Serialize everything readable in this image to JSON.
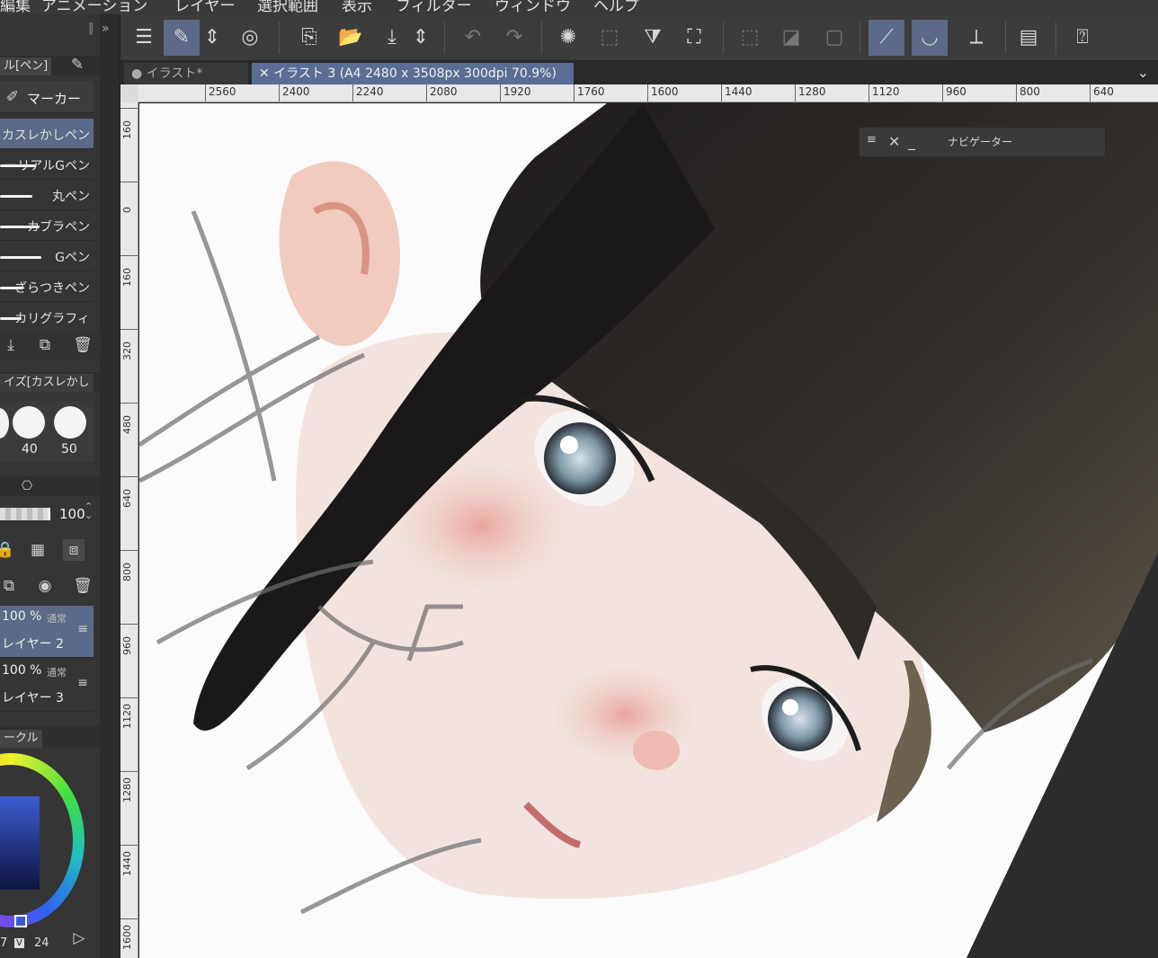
{
  "menu": [
    "編集",
    "アニメーション",
    "レイヤー",
    "選択範囲",
    "表示",
    "フィルター",
    "ウィンドウ",
    "ヘルプ"
  ],
  "tool_panel": {
    "tabs": [
      "ル[ペン]"
    ],
    "group": "マーカー",
    "brushes": [
      "カスレかしペン",
      "ーリアルGペン",
      "丸ペン",
      "カブラペン",
      "Gペン",
      "ざらつきペン",
      "カリグラフィ"
    ],
    "selected_brush_index": 0
  },
  "brush_size": {
    "title": "イズ[カスレかし",
    "labels": [
      "40",
      "50"
    ]
  },
  "opacity": {
    "value": "100"
  },
  "layers": [
    {
      "opacity": "100 %",
      "mode": "通常",
      "name": "レイヤー 2",
      "selected": true
    },
    {
      "opacity": "100 %",
      "mode": "通常",
      "name": "レイヤー 3",
      "selected": false
    }
  ],
  "color_panel": {
    "tab": "ークル",
    "readout_a": "7",
    "readout_v_label": "V",
    "readout_v": "24"
  },
  "doc_tabs": [
    {
      "label": "● イラスト*",
      "active": false
    },
    {
      "label": "✕ イラスト 3 (A4 2480 x 3508px 300dpi 70.9%)",
      "active": true
    }
  ],
  "ruler": {
    "h_labels": [
      "2560",
      "2400",
      "2240",
      "2080",
      "1920",
      "1760",
      "1600",
      "1440",
      "1280",
      "1120",
      "960",
      "800",
      "640"
    ],
    "v_labels": [
      "160",
      "0",
      "160",
      "320",
      "480",
      "640",
      "800",
      "960",
      "1120",
      "1280",
      "1440",
      "1600"
    ]
  },
  "navigator": {
    "title": "ナビゲーター"
  },
  "colors": {
    "accent": "#5b6a88",
    "doc_tab_active": "#5a6d94",
    "panel": "#353535",
    "toolbar": "#3c3c3c"
  }
}
